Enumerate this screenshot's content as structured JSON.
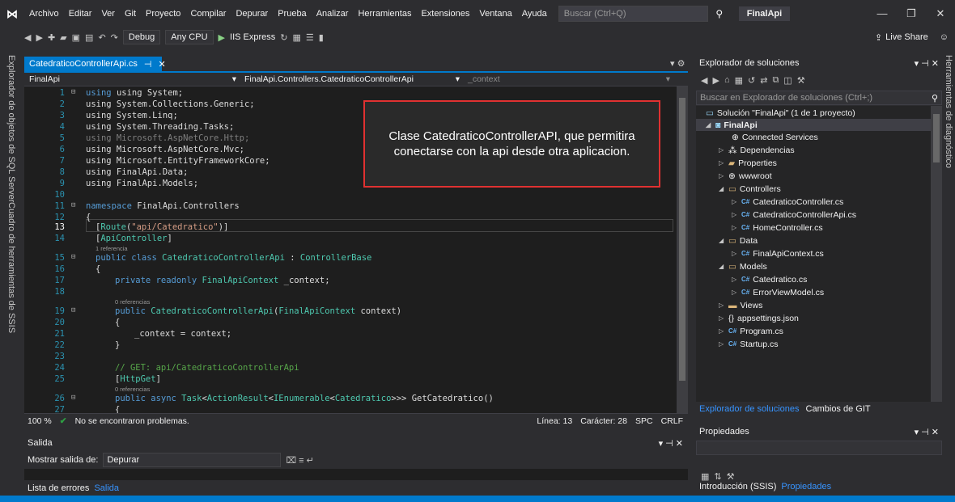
{
  "menu": {
    "items": [
      "Archivo",
      "Editar",
      "Ver",
      "Git",
      "Proyecto",
      "Compilar",
      "Depurar",
      "Prueba",
      "Analizar",
      "Herramientas",
      "Extensiones",
      "Ventana",
      "Ayuda"
    ],
    "search_placeholder": "Buscar (Ctrl+Q)",
    "project_name": "FinalApi"
  },
  "toolbar": {
    "config": "Debug",
    "platform": "Any CPU",
    "run_target": "IIS Express",
    "live_share": "Live Share"
  },
  "side_left": {
    "tab1": "Explorador de objetos de SQL Server",
    "tab2": "Cuadro de herramientas de SSIS"
  },
  "side_right": {
    "tab1": "Herramientas de diagnóstico"
  },
  "editor": {
    "doc_tab": "CatedraticoControllerApi.cs",
    "nav_project": "FinalApi",
    "nav_class": "FinalApi.Controllers.CatedraticoControllerApi",
    "nav_member": "_context",
    "lines": {
      "l1": "using System;",
      "l2": "using System.Collections.Generic;",
      "l3": "using System.Linq;",
      "l4": "using System.Threading.Tasks;",
      "l5": "using Microsoft.AspNetCore.Http;",
      "l6": "using Microsoft.AspNetCore.Mvc;",
      "l7": "using Microsoft.EntityFrameworkCore;",
      "l8": "using FinalApi.Data;",
      "l9": "using FinalApi.Models;",
      "l11_kw": "namespace",
      "l11_rest": " FinalApi.Controllers",
      "l12": "{",
      "l13_a": "[",
      "l13_b": "Route",
      "l13_c": "(",
      "l13_d": "\"api/Catedratico\"",
      "l13_e": ")]",
      "l14_a": "[",
      "l14_b": "ApiController",
      "l14_c": "]",
      "ref1": "1 referencia",
      "l15_kw": "public class",
      "l15_ty": " CatedraticoControllerApi",
      "l15_mid": " : ",
      "l15_base": "ControllerBase",
      "l16": "{",
      "l17_kw": "private readonly",
      "l17_ty": " FinalApiContext",
      "l17_rest": " _context;",
      "ref2": "0 referencias",
      "l19_kw": "public",
      "l19_ty": " CatedraticoControllerApi",
      "l19_a": "(",
      "l19_ty2": "FinalApiContext",
      "l19_rest": " context)",
      "l20": "{",
      "l21": "_context = context;",
      "l22": "}",
      "l24": "// GET: api/CatedraticoControllerApi",
      "l25_a": "[",
      "l25_b": "HttpGet",
      "l25_c": "]",
      "ref3": "0 referencias",
      "l26_kw": "public async",
      "l26_ty": " Task",
      "l26_a": "<",
      "l26_ty2": "ActionResult",
      "l26_b": "<",
      "l26_ty3": "IEnumerable",
      "l26_c": "<",
      "l26_ty4": "Catedratico",
      "l26_rest": ">>> GetCatedratico()",
      "l27": "{"
    },
    "callout": "Clase CatedraticoControllerAPI, que permitira conectarse con la api desde otra aplicacion.",
    "status": {
      "zoom": "100 %",
      "problems": "No se encontraron problemas.",
      "line": "Línea: 13",
      "char": "Carácter: 28",
      "spc": "SPC",
      "crlf": "CRLF"
    }
  },
  "output": {
    "title": "Salida",
    "source_label": "Mostrar salida de:",
    "source_value": "Depurar",
    "tab_errors": "Lista de errores",
    "tab_output": "Salida"
  },
  "solution_explorer": {
    "title": "Explorador de soluciones",
    "search_placeholder": "Buscar en Explorador de soluciones (Ctrl+;)",
    "tree": {
      "solution": "Solución \"FinalApi\" (1 de 1 proyecto)",
      "project": "FinalApi",
      "connected": "Connected Services",
      "deps": "Dependencias",
      "properties": "Properties",
      "wwwroot": "wwwroot",
      "controllers": "Controllers",
      "c1": "CatedraticoController.cs",
      "c2": "CatedraticoControllerApi.cs",
      "c3": "HomeController.cs",
      "data": "Data",
      "d1": "FinalApiContext.cs",
      "models": "Models",
      "m1": "Catedratico.cs",
      "m2": "ErrorViewModel.cs",
      "views": "Views",
      "appsettings": "appsettings.json",
      "program": "Program.cs",
      "startup": "Startup.cs"
    },
    "tab_se": "Explorador de soluciones",
    "tab_git": "Cambios de GIT"
  },
  "properties": {
    "title": "Propiedades",
    "tab_intro": "Introducción (SSIS)",
    "tab_props": "Propiedades"
  }
}
